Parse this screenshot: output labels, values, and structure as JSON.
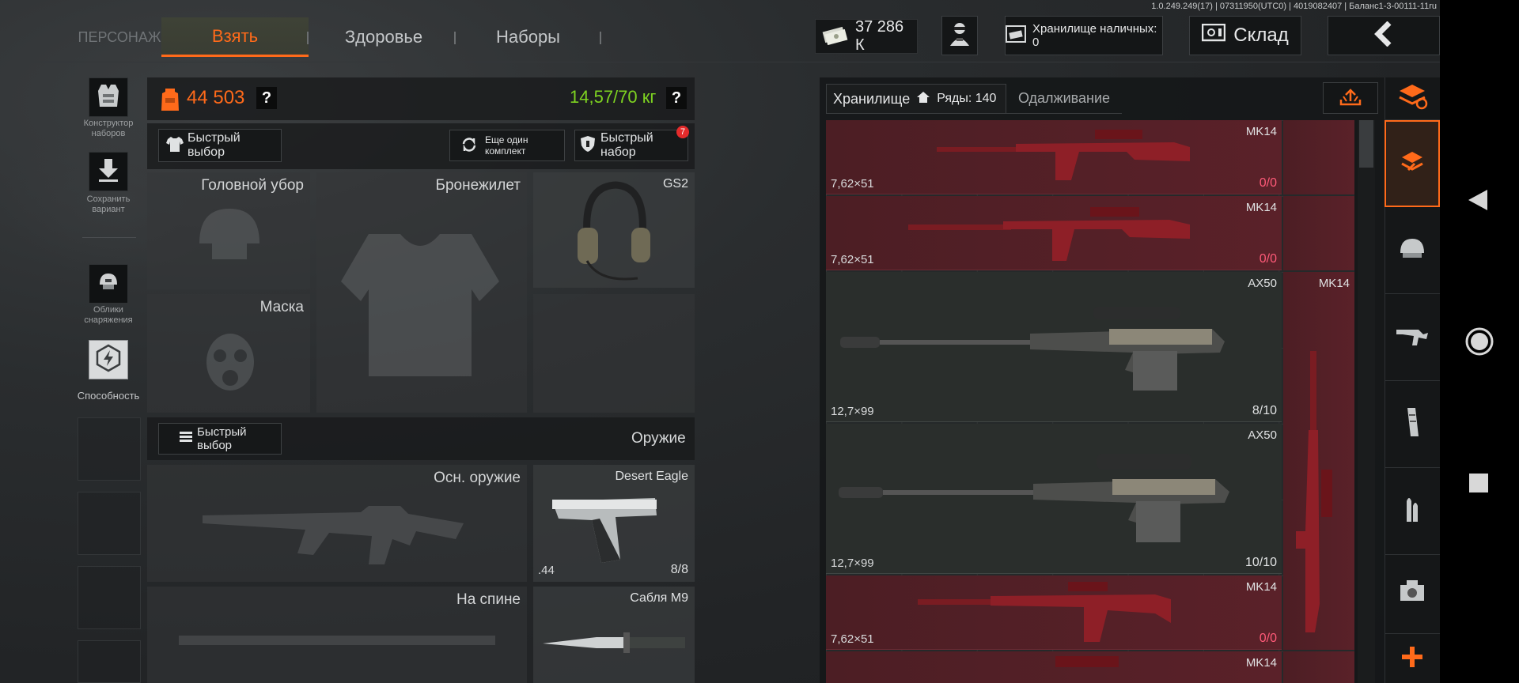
{
  "build_info": "1.0.249.249(17) | 07311950(UTC0) | 4019082407 | Баланс1-3-00111-11ru",
  "tabs": {
    "character": "ПЕРСОНАЖ",
    "take": "Взять",
    "health": "Здоровье",
    "kits": "Наборы"
  },
  "top": {
    "money": "37 286 К",
    "cash_storage": "Хранилище наличных: 0",
    "warehouse": "Склад"
  },
  "colors": {
    "accent": "#ff6a1a",
    "weight_green": "#7ed321",
    "ammo_zero": "#ff5a78",
    "storage_red": "#5a2129",
    "badge": "#e52b2b"
  },
  "left_sidebar": {
    "kit_builder": "Конструктор наборов",
    "save_variant": "Сохранить вариант",
    "gear_skins": "Облики снаряжения",
    "ability": "Способность"
  },
  "equipment": {
    "value": "44 503",
    "help": "?",
    "weight": "14,57/70 кг",
    "quick_select": "Быстрый выбор",
    "another_set": "Еще один комплект",
    "quick_kit": "Быстрый набор",
    "quick_kit_badge": "7",
    "headwear": "Головной убор",
    "armor": "Бронежилет",
    "headset": "GS2",
    "mask": "Маска",
    "weapons_quick": "Быстрый выбор",
    "weapons_title": "Оружие",
    "primary": "Осн. оружие",
    "pistol_name": "Desert Eagle",
    "pistol_caliber": ".44",
    "pistol_ammo": "8/8",
    "back": "На спине",
    "knife": "Сабля М9"
  },
  "storage": {
    "tab_storage": "Хранилище",
    "rows_label": "Ряды: 140",
    "tab_lending": "Одалживание",
    "items": [
      {
        "name": "MK14",
        "caliber": "7,62×51",
        "ammo": "0/0"
      },
      {
        "name": "MK14",
        "caliber": "7,62×51",
        "ammo": "0/0"
      },
      {
        "name": "AX50",
        "caliber": "12,7×99",
        "ammo": "8/10"
      },
      {
        "name": "AX50",
        "caliber": "12,7×99",
        "ammo": "10/10"
      },
      {
        "name": "MK14",
        "caliber": "7,62×51",
        "ammo": "0/0"
      },
      {
        "name": "MK14",
        "caliber": "",
        "ammo": ""
      }
    ],
    "vertical_item": "MK14"
  },
  "icons": [
    "stack-icon",
    "backpack-icon",
    "helmet-icon",
    "rifle-icon",
    "magazine-icon",
    "bullets-icon",
    "sight-icon",
    "plus-icon",
    "back-arrow-icon",
    "home-circle-icon",
    "square-icon",
    "triangle-back-icon"
  ]
}
